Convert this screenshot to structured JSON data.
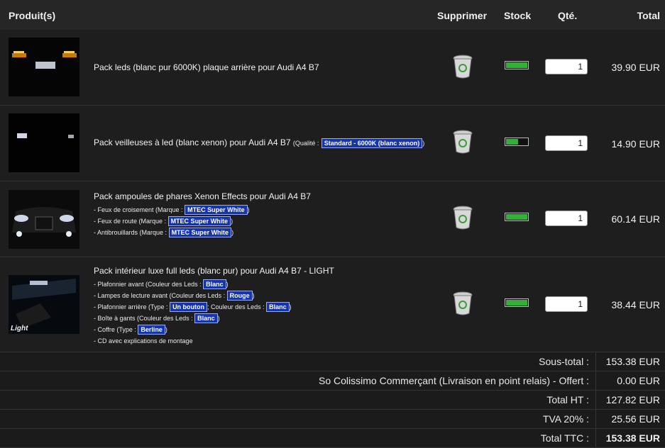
{
  "header": {
    "product": "Produit(s)",
    "delete": "Supprimer",
    "stock": "Stock",
    "qty": "Qté.",
    "total": "Total"
  },
  "items": [
    {
      "title": "Pack leds (blanc pur 6000K) plaque arrière pour Audi A4 B7",
      "inline_label": "",
      "inline_value": "",
      "options": [],
      "stock_level": 1.0,
      "qty": "1",
      "price": "39.90 EUR"
    },
    {
      "title": "Pack veilleuses à led (blanc xenon) pour Audi A4 B7",
      "inline_label": "(Qualité :",
      "inline_value": "Standard - 6000K (blanc xenon)",
      "options": [],
      "stock_level": 0.55,
      "qty": "1",
      "price": "14.90 EUR"
    },
    {
      "title": "Pack ampoules de phares Xenon Effects pour Audi A4 B7",
      "options": [
        {
          "text": "- Feux de croisement  (Marque :",
          "tag": "MTEC Super White"
        },
        {
          "text": "- Feux de route  (Marque :",
          "tag": "MTEC Super White"
        },
        {
          "text": "- Antibrouillards  (Marque :",
          "tag": "MTEC Super White"
        }
      ],
      "stock_level": 1.0,
      "qty": "1",
      "price": "60.14 EUR"
    },
    {
      "title": "Pack intérieur luxe full leds (blanc pur) pour Audi A4 B7 - LIGHT",
      "options": [
        {
          "text": "- Plafonnier avant  (Couleur des Leds :",
          "tag": "Blanc"
        },
        {
          "text": "- Lampes de lecture avant  (Couleur des Leds :",
          "tag": "Rouge"
        },
        {
          "text": "- Plafonnier arrière  (Type :",
          "tag": "Un bouton",
          "text2": "; Couleur des Leds :",
          "tag2": "Blanc"
        },
        {
          "text": "- Boîte à gants  (Couleur des Leds :",
          "tag": "Blanc"
        },
        {
          "text": "- Coffre  (Type :",
          "tag": "Berline"
        },
        {
          "text": "- CD avec explications de montage",
          "tag": ""
        }
      ],
      "thumb_caption": "Light",
      "stock_level": 1.0,
      "qty": "1",
      "price": "38.44 EUR"
    }
  ],
  "summary": [
    {
      "label": "Sous-total :",
      "value": "153.38 EUR"
    },
    {
      "label": "So Colissimo Commerçant (Livraison en point relais) - Offert :",
      "value": "0.00 EUR"
    },
    {
      "label": "Total HT :",
      "value": "127.82 EUR"
    },
    {
      "label": "TVA 20% :",
      "value": "25.56 EUR"
    },
    {
      "label": "Total TTC :",
      "value": "153.38 EUR"
    }
  ],
  "icons": {
    "delete": "trash-bin-icon",
    "stock": "stock-battery-icon"
  },
  "colors": {
    "stock_green": "#34b03a",
    "tag_blue": "#1635a8"
  }
}
